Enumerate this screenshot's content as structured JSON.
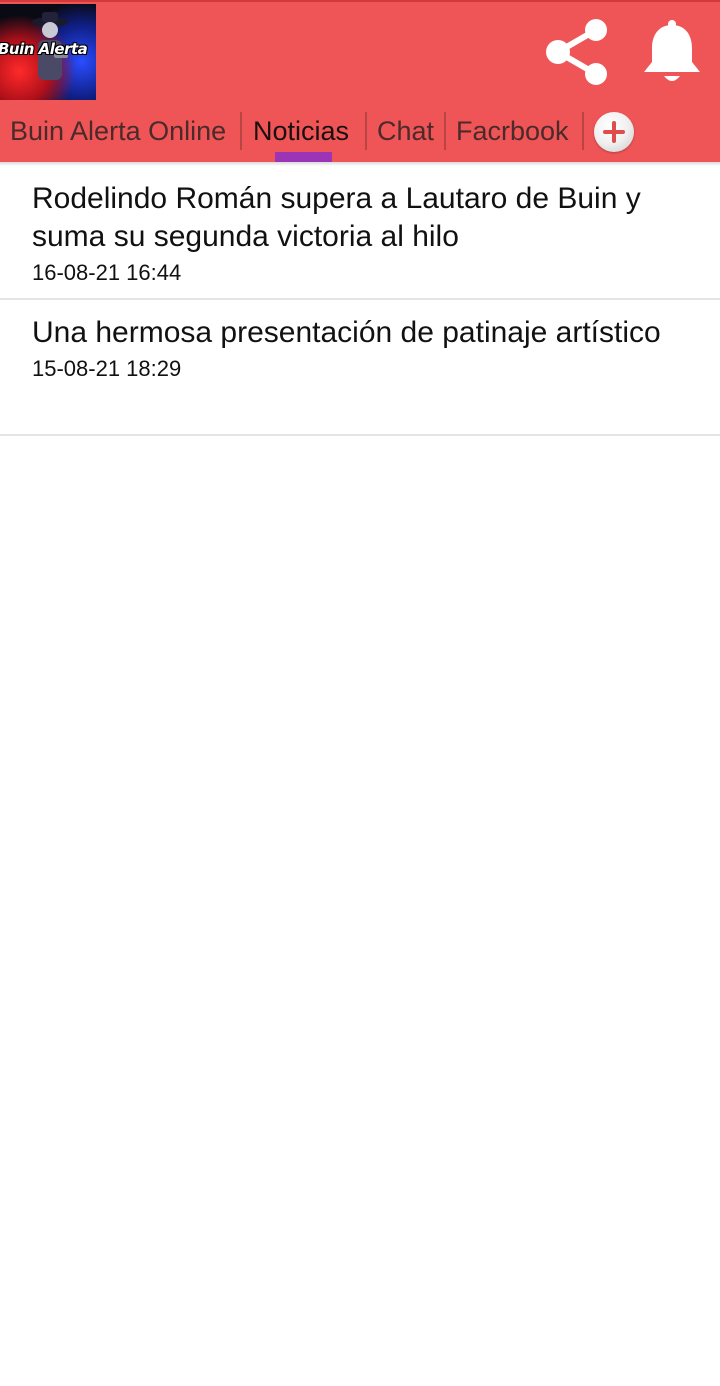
{
  "app": {
    "logo_text": "Buin Alerta"
  },
  "tabs": [
    {
      "label": "Buin Alerta Online",
      "active": false
    },
    {
      "label": "Noticias",
      "active": true
    },
    {
      "label": "Chat",
      "active": false
    },
    {
      "label": "Facrbook",
      "active": false
    }
  ],
  "icons": {
    "share": "share-icon",
    "notifications": "bell-icon",
    "add_tab": "plus-icon"
  },
  "colors": {
    "header_bg": "#ef5556",
    "tab_indicator": "#9b35b5",
    "icon_color": "#ffffff"
  },
  "news": [
    {
      "title": "Rodelindo Román supera a Lautaro de Buin y suma su segunda victoria al hilo",
      "date": "16-08-21 16:44"
    },
    {
      "title": "Una hermosa presentación de patinaje artístico",
      "date": "15-08-21 18:29"
    }
  ]
}
